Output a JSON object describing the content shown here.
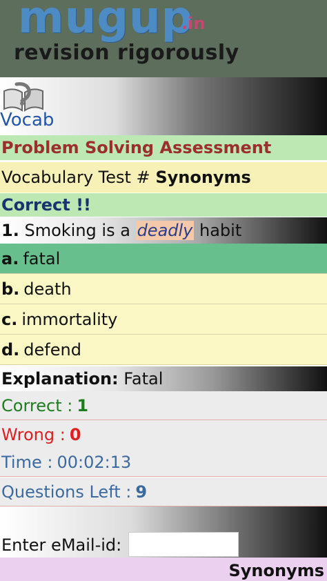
{
  "header": {
    "logo_text_main": "mugup",
    "logo_text_suffix": ".in",
    "tagline": "revision rigorously"
  },
  "vocab": {
    "icon": "book-icon",
    "label": "Vocab"
  },
  "assessment": {
    "title": "Problem Solving Assessment",
    "subtitle_prefix": "Vocabulary Test #",
    "subtitle_topic": "Synonyms",
    "status": "Correct !!"
  },
  "question": {
    "number": "1.",
    "text_before": "Smoking is a",
    "keyword": "deadly",
    "text_after": "habit"
  },
  "options": [
    {
      "letter": "a.",
      "text": "fatal"
    },
    {
      "letter": "b.",
      "text": "death"
    },
    {
      "letter": "c.",
      "text": "immortality"
    },
    {
      "letter": "d.",
      "text": "defend"
    }
  ],
  "explanation": {
    "label": "Explanation:",
    "text": "Fatal"
  },
  "stats": {
    "correct_label": "Correct :",
    "correct_value": "1",
    "wrong_label": "Wrong :",
    "wrong_value": "0",
    "time_label": "Time :",
    "time_value": "00:02:13",
    "left_label": "Questions Left :",
    "left_value": "9"
  },
  "email": {
    "label": "Enter eMail-id:",
    "value": ""
  },
  "footer": {
    "label": "Synonyms"
  },
  "colors": {
    "header_bg": "#5e6e5c",
    "logo_blue": "#4d8bc4",
    "logo_pink": "#c7486f",
    "title_green_bg": "#bde8b3",
    "title_red": "#9b2e2e",
    "selected_option_bg": "#66bf8c",
    "option_bg": "#fcf8c6",
    "correct_green": "#1e7d1e",
    "wrong_red": "#e02020",
    "info_blue": "#3a6aa0",
    "footer_bg": "#ecd0f0"
  }
}
